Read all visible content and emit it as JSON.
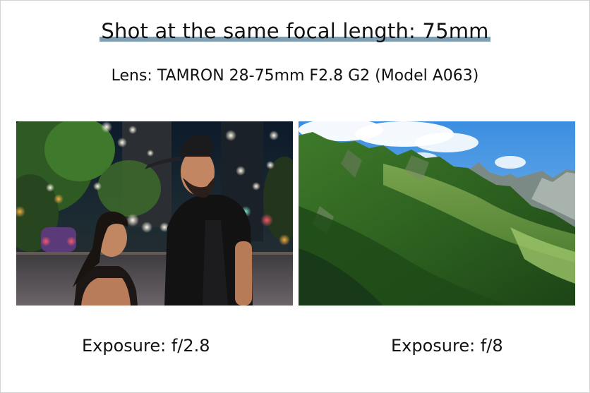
{
  "header": {
    "title": "Shot at the same focal length: 75mm",
    "subtitle": "Lens: TAMRON 28-75mm F2.8 G2 (Model A063)"
  },
  "photos": [
    {
      "scene": "portrait of a couple at night on a city street with bokeh lights",
      "caption": "Exposure: f/2.8"
    },
    {
      "scene": "green forested mountain range under blue sky with clouds",
      "caption": "Exposure: f/8"
    }
  ],
  "colors": {
    "title_highlight": "#7f9eb2",
    "text": "#111111",
    "background": "#ffffff"
  }
}
